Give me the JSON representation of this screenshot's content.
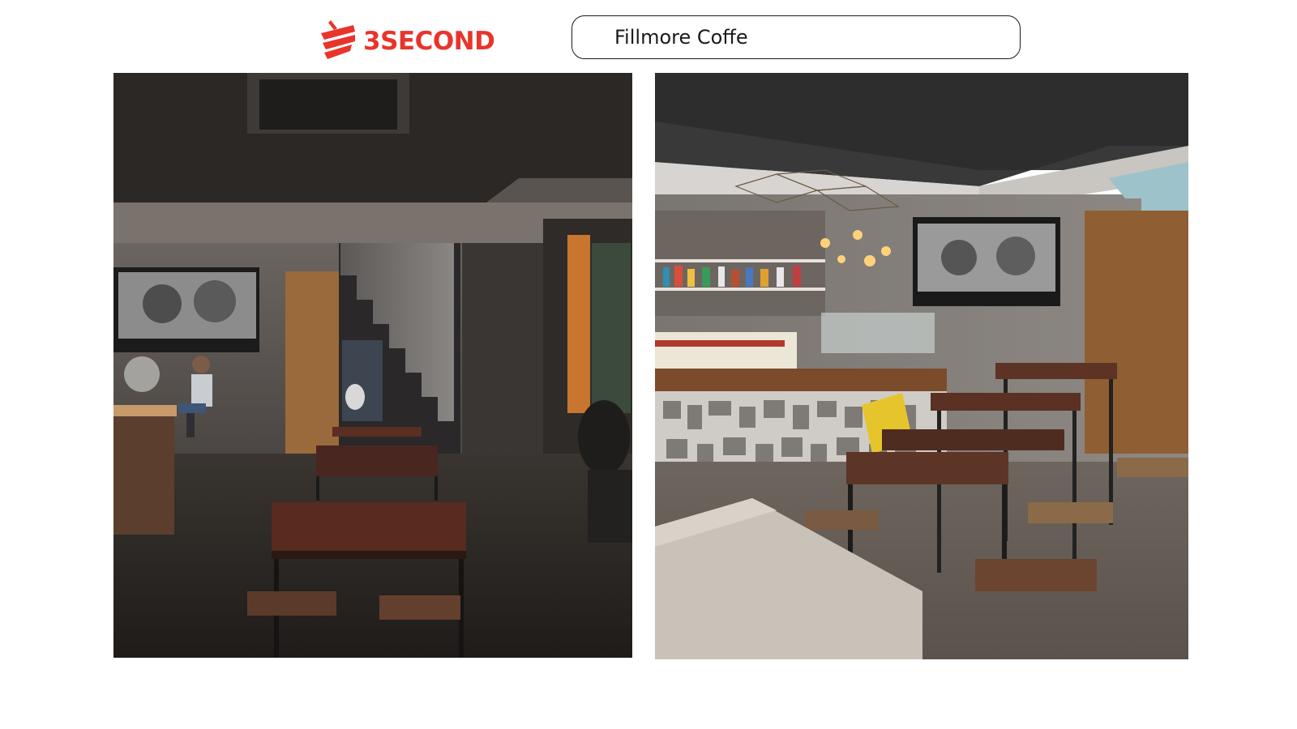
{
  "header": {
    "brand_name": "3SECOND",
    "brand_color": "#e8352b",
    "location_title": "Fillmore Coffe"
  },
  "photos": [
    {
      "id": "left",
      "icon": "cafe-interior-night-photo"
    },
    {
      "id": "right",
      "icon": "cafe-interior-bar-counter-photo"
    }
  ]
}
